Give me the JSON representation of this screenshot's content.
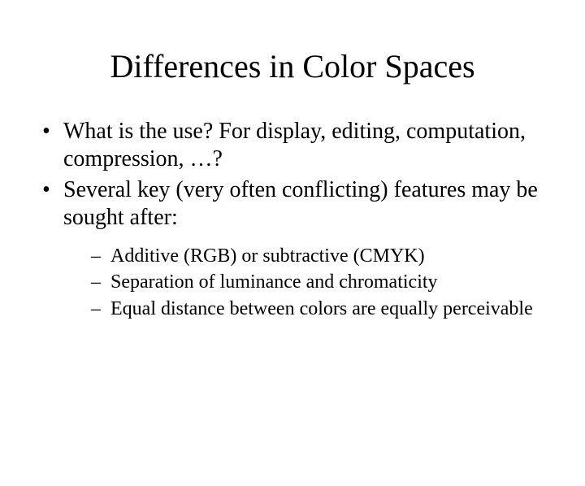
{
  "title": "Differences in Color Spaces",
  "bullets": [
    "What is the use? For display, editing, computation, compression, …?",
    "Several key (very often conflicting) features may be sought after:"
  ],
  "subbullets": [
    "Additive (RGB) or subtractive (CMYK)",
    "Separation of luminance and chromaticity",
    "Equal distance between colors are equally perceivable"
  ]
}
